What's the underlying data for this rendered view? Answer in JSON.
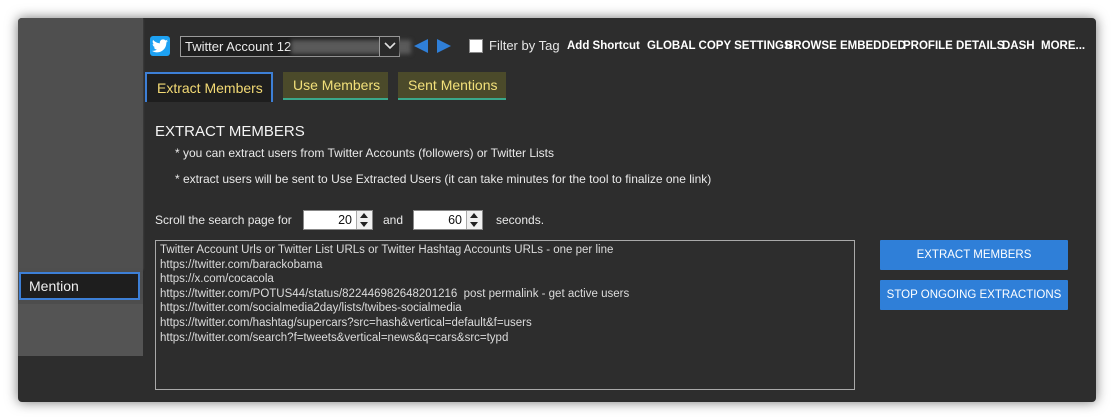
{
  "sidebar": {
    "selected_item": "Mention"
  },
  "topbar": {
    "account_value": "Twitter Account 12 -",
    "filter_label": "Filter by Tag",
    "menu": [
      "Add Shortcut",
      "GLOBAL COPY SETTINGS",
      "BROWSE EMBEDDED",
      "PROFILE DETAILS",
      "DASH",
      "MORE..."
    ]
  },
  "tabs": [
    "Extract Members",
    "Use Members",
    "Sent Mentions"
  ],
  "main": {
    "heading": "EXTRACT MEMBERS",
    "note1": "* you can extract users from Twitter Accounts (followers) or Twitter Lists",
    "note2": "* extract users will be sent to Use Extracted Users (it can take minutes for the tool to finalize one link)",
    "scroll_label": "Scroll the search page for",
    "scroll_min": "20",
    "and_label": "and",
    "scroll_max": "60",
    "seconds_label": "seconds.",
    "urls_text": "Twitter Account Urls or Twitter List URLs or Twitter Hashtag Accounts URLs - one per line\nhttps://twitter.com/barackobama\nhttps://x.com/cocacola\nhttps://twitter.com/POTUS44/status/822446982648201216  post permalink - get active users\nhttps://twitter.com/socialmedia2day/lists/twibes-socialmedia\nhttps://twitter.com/hashtag/supercars?src=hash&vertical=default&f=users\nhttps://twitter.com/search?f=tweets&vertical=news&q=cars&src=typd",
    "extract_button": "EXTRACT MEMBERS",
    "stop_button": "STOP ONGOING EXTRACTIONS"
  },
  "colors": {
    "background": "#2d2d2d",
    "accent_blue": "#2f7fd8",
    "tab_text": "#f2e07a",
    "tab_inactive_bg": "#4b4a2a"
  },
  "icons": [
    "twitter-icon",
    "chevron-down-icon",
    "arrow-left-icon",
    "arrow-right-icon"
  ]
}
